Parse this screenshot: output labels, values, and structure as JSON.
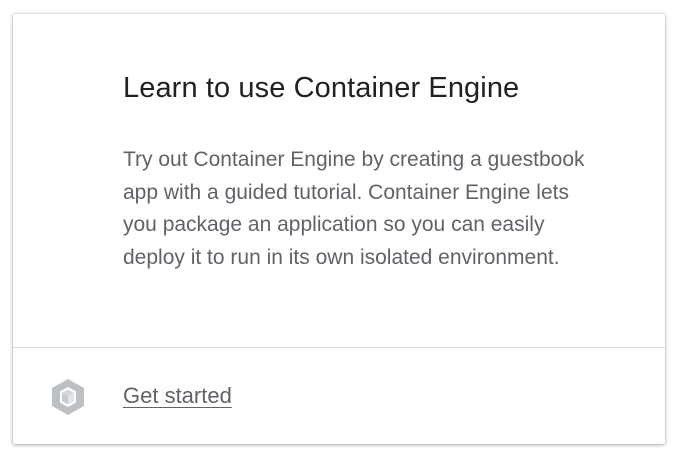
{
  "card": {
    "title": "Learn to use Container Engine",
    "description": "Try out Container Engine by creating a guestbook app with a guided tutorial. Container Engine lets you package an application so you can easily deploy it to run in its own isolated environment.",
    "footer": {
      "icon": "container-engine-icon",
      "link_label": "Get started"
    }
  },
  "colors": {
    "title": "#202124",
    "text": "#5f6368",
    "icon": "#bdc1c6",
    "divider": "#dcdcdc"
  }
}
